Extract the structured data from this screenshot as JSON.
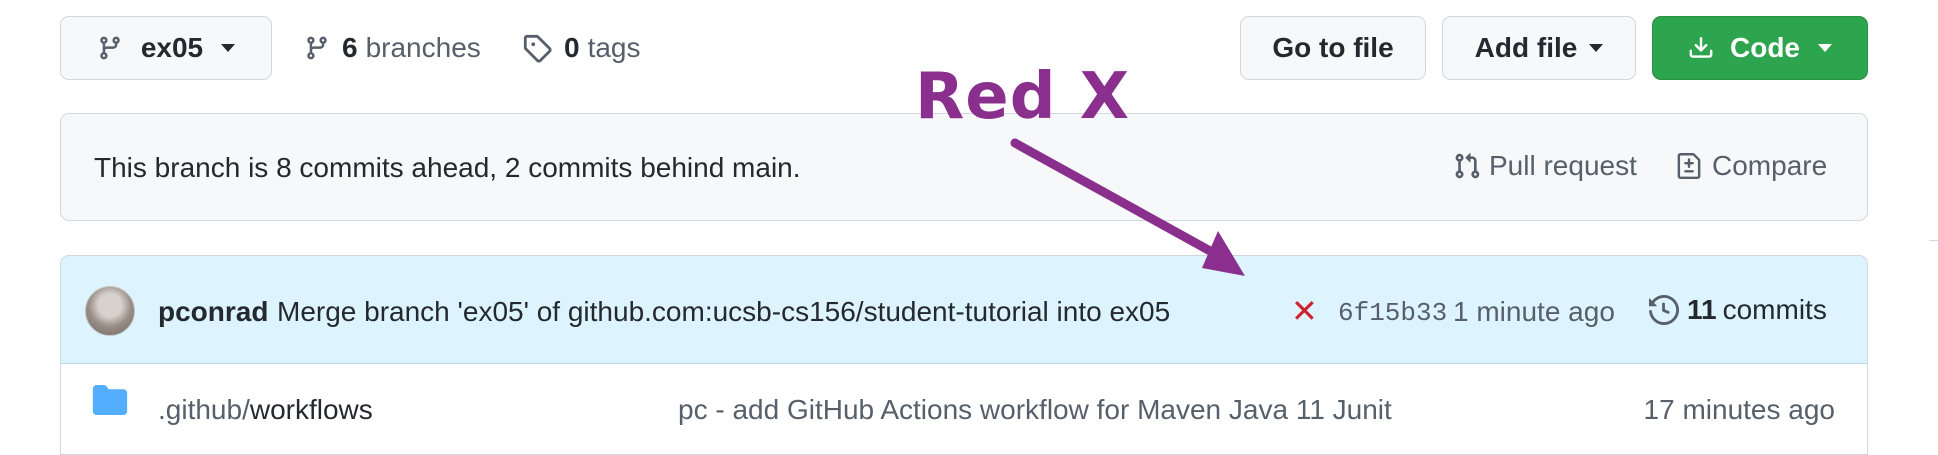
{
  "branch_select": {
    "label": "ex05"
  },
  "branches": {
    "count": "6",
    "label": "branches"
  },
  "tags": {
    "count": "0",
    "label": "tags"
  },
  "toolbar": {
    "go_to_file": "Go to file",
    "add_file": "Add file",
    "code": "Code"
  },
  "banner": {
    "text": "This branch is 8 commits ahead, 2 commits behind main.",
    "pull_request": "Pull request",
    "compare": "Compare"
  },
  "latest_commit": {
    "author": "pconrad",
    "message": "Merge branch 'ex05' of github.com:ucsb-cs156/student-tutorial into ex05",
    "status": "✕",
    "sha": "6f15b33",
    "time": "1 minute ago",
    "commits_count": "11",
    "commits_label": "commits"
  },
  "files": [
    {
      "name_prefix": ".github/",
      "name_leaf": "workflows",
      "message": "pc - add GitHub Actions workflow for Maven Java 11 Junit",
      "time": "17 minutes ago"
    }
  ],
  "annotation": {
    "text": "Red X",
    "color": "#8a2f8d"
  },
  "colors": {
    "code_button": "#2da44e",
    "error_red": "#cf222e",
    "banner_bg": "#f6f8fa",
    "commit_row_bg": "#ddf4ff",
    "folder": "#54aeff"
  }
}
